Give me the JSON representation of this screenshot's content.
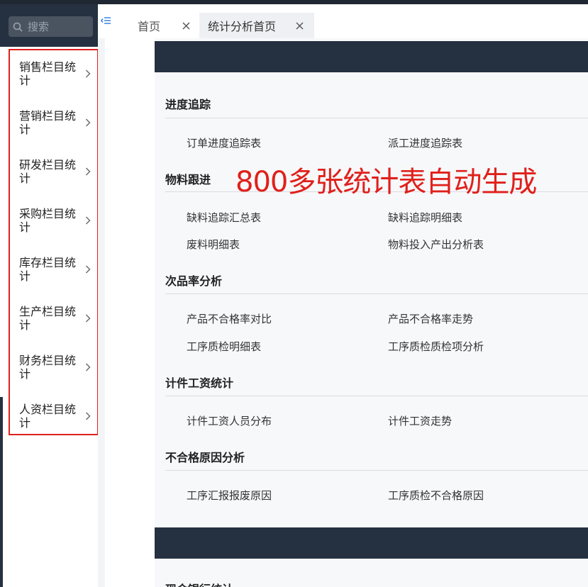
{
  "search": {
    "placeholder": "搜索"
  },
  "sidebar": {
    "items": [
      {
        "label": "销售栏目统计"
      },
      {
        "label": "营销栏目统计"
      },
      {
        "label": "研发栏目统计"
      },
      {
        "label": "采购栏目统计"
      },
      {
        "label": "库存栏目统计"
      },
      {
        "label": "生产栏目统计"
      },
      {
        "label": "财务栏目统计"
      },
      {
        "label": "人资栏目统计"
      }
    ]
  },
  "tabs": [
    {
      "label": "首页"
    },
    {
      "label": "统计分析首页"
    }
  ],
  "overlay": {
    "text": "800多张统计表自动生成"
  },
  "sections": [
    {
      "title": "进度追踪",
      "links": [
        "订单进度追踪表",
        "派工进度追踪表"
      ]
    },
    {
      "title": "物料跟进",
      "links": [
        "缺料追踪汇总表",
        "缺料追踪明细表",
        "废料明细表",
        "物料投入产出分析表"
      ]
    },
    {
      "title": "次品率分析",
      "links": [
        "产品不合格率对比",
        "产品不合格率走势",
        "工序质检明细表",
        "工序质检质检项分析"
      ]
    },
    {
      "title": "计件工资统计",
      "links": [
        "计件工资人员分布",
        "计件工资走势"
      ]
    },
    {
      "title": "不合格原因分析",
      "links": [
        "工序汇报报废原因",
        "工序质检不合格原因"
      ]
    }
  ],
  "next_section": {
    "title": "现金银行统计"
  },
  "colors": {
    "dark": "#253040",
    "highlight_red": "#e0201b"
  }
}
